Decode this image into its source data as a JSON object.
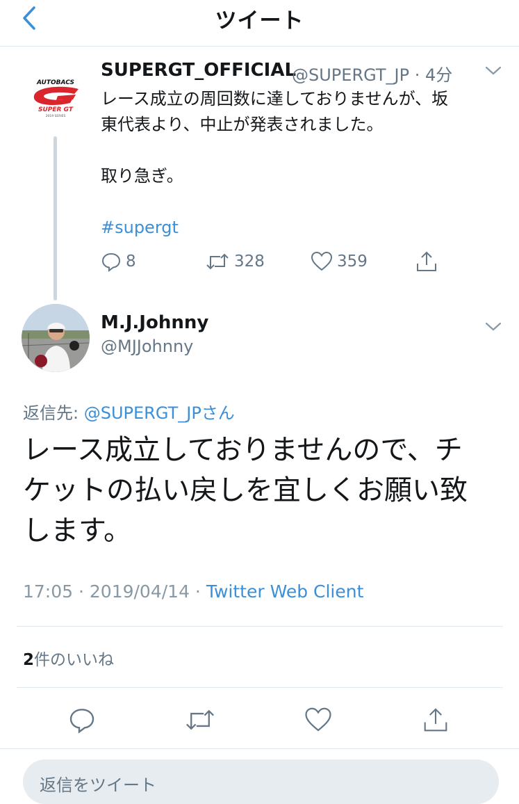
{
  "header": {
    "title": "ツイート"
  },
  "parent_tweet": {
    "name": "SUPERGT_OFFICIAL",
    "handle_time": "@SUPERGT_JP · 4分",
    "avatar_text": {
      "top": "AUTOBACS",
      "bottom": "SUPER GT",
      "small": "2019 SERIES"
    },
    "text_lines": [
      "レース成立の周回数に達しておりませんが、坂",
      "東代表より、中止が発表されました。",
      "",
      "取り急ぎ。",
      ""
    ],
    "hashtag": "#supergt",
    "reply_count": "8",
    "retweet_count": "328",
    "like_count": "359"
  },
  "reply_tweet": {
    "name": "M.J.Johnny",
    "handle": "@MJJohnny",
    "reply_to_label": "返信先: ",
    "reply_to_mention": "@SUPERGT_JPさん",
    "text_lines": [
      "レース成立しておりませんので、チ",
      "ケットの払い戻しを宜しくお願い致",
      "します。"
    ],
    "timestamp": "17:05 · 2019/04/14 · ",
    "client": "Twitter Web Client",
    "likes_count": "2",
    "likes_label": "件のいいね"
  },
  "composer": {
    "placeholder": "返信をツイート"
  },
  "colors": {
    "accent": "#3b8fd9",
    "secondary_text": "#657786",
    "brand_red": "#d9252b"
  },
  "icons": [
    "back-chevron-icon",
    "caret-down-icon",
    "reply-icon",
    "retweet-icon",
    "like-icon",
    "share-icon"
  ]
}
